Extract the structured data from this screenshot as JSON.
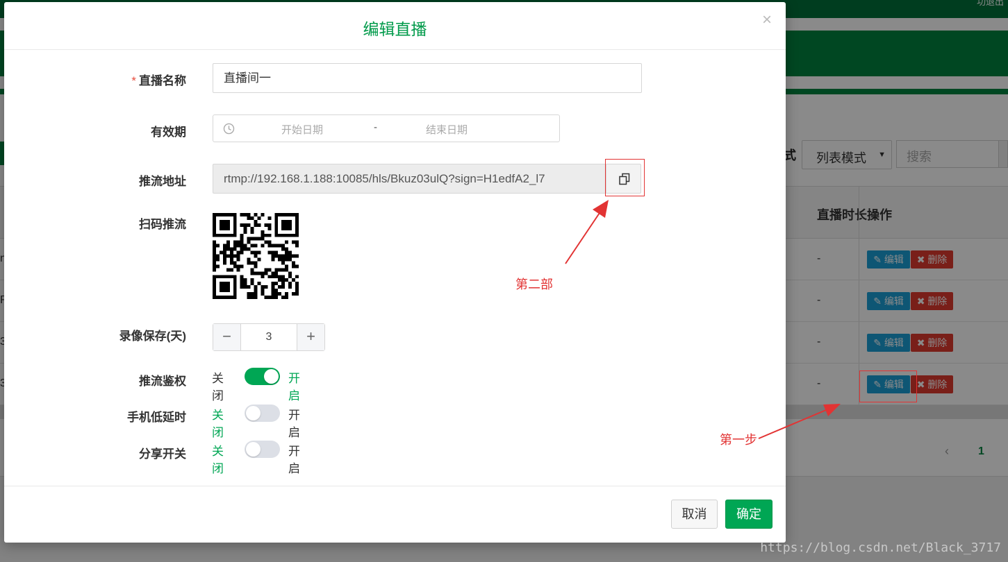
{
  "background": {
    "topbar_text": "功退出",
    "mode_label": "式",
    "mode_select": "列表模式",
    "search_placeholder": "搜索",
    "col_headers": [
      "直播时长",
      "操作"
    ],
    "rows": [
      {
        "left_char": "n",
        "duration": "-",
        "edit": "编辑",
        "delete": "删除"
      },
      {
        "left_char": "R",
        "duration": "-",
        "edit": "编辑",
        "delete": "删除"
      },
      {
        "left_char": "3",
        "duration": "-",
        "edit": "编辑",
        "delete": "删除"
      },
      {
        "left_char": "3",
        "duration": "-",
        "edit": "编辑",
        "delete": "删除"
      }
    ],
    "pager_prev": "‹",
    "pager_current": "1"
  },
  "modal": {
    "title": "编辑直播",
    "close": "×",
    "fields": {
      "name_label": "直播名称",
      "name_required": "*",
      "name_value": "直播间一",
      "validity_label": "有效期",
      "start_placeholder": "开始日期",
      "range_separator": "-",
      "end_placeholder": "结束日期",
      "push_url_label": "推流地址",
      "push_url_value": "rtmp://192.168.1.188:10085/hls/Bkuz03ulQ?sign=H1edfA2_l7",
      "qr_label": "扫码推流",
      "record_label": "录像保存(天)",
      "record_value": "3",
      "stepper_minus": "−",
      "stepper_plus": "+",
      "auth_label": "推流鉴权",
      "lowlatency_label": "手机低延时",
      "share_label": "分享开关",
      "off_text": "关闭",
      "on_text": "开启"
    },
    "switches": {
      "auth": true,
      "lowlatency": false,
      "share": false
    },
    "cancel_label": "取消",
    "ok_label": "确定"
  },
  "annotations": {
    "step_two": "第二部",
    "step_one": "第一步"
  },
  "watermark": "https://blog.csdn.net/Black_3717",
  "colors": {
    "accent": "#00a654",
    "annotation": "#e23333",
    "edit_button": "#1a9fd6",
    "delete_button": "#e03a2f"
  }
}
